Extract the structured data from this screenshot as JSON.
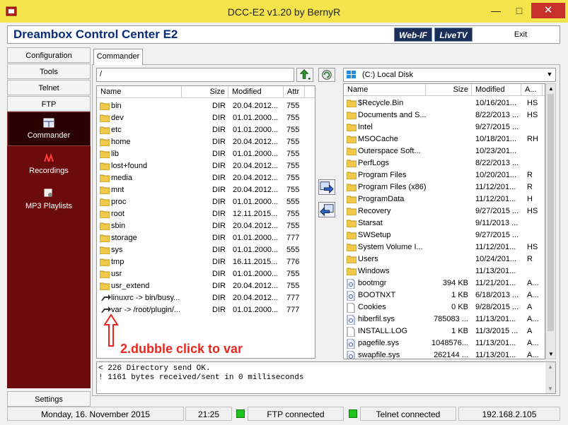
{
  "window": {
    "title": "DCC-E2 v1.20 by BernyR",
    "min": "—",
    "max": "□",
    "close": "✕"
  },
  "header": {
    "app_name": "Dreambox Control Center E2",
    "webif": "Web-IF",
    "livetv": "LiveTV",
    "exit": "Exit"
  },
  "nav": {
    "configuration": "Configuration",
    "tools": "Tools",
    "telnet": "Telnet",
    "ftp": "FTP",
    "commander": "Commander",
    "recordings": "Recordings",
    "mp3": "MP3 Playlists",
    "settings": "Settings"
  },
  "tab": {
    "commander": "Commander"
  },
  "remote": {
    "path": "/",
    "columns": {
      "name": "Name",
      "size": "Size",
      "modified": "Modified",
      "attr": "Attr"
    },
    "rows": [
      {
        "name": "bin",
        "size": "DIR",
        "modified": "20.04.2012...",
        "attr": "755",
        "icon": "folder-icon"
      },
      {
        "name": "dev",
        "size": "DIR",
        "modified": "01.01.2000...",
        "attr": "755",
        "icon": "folder-icon"
      },
      {
        "name": "etc",
        "size": "DIR",
        "modified": "01.01.2000...",
        "attr": "755",
        "icon": "folder-icon"
      },
      {
        "name": "home",
        "size": "DIR",
        "modified": "20.04.2012...",
        "attr": "755",
        "icon": "folder-icon"
      },
      {
        "name": "lib",
        "size": "DIR",
        "modified": "01.01.2000...",
        "attr": "755",
        "icon": "folder-icon"
      },
      {
        "name": "lost+found",
        "size": "DIR",
        "modified": "20.04.2012...",
        "attr": "755",
        "icon": "folder-icon"
      },
      {
        "name": "media",
        "size": "DIR",
        "modified": "20.04.2012...",
        "attr": "755",
        "icon": "folder-icon"
      },
      {
        "name": "mnt",
        "size": "DIR",
        "modified": "20.04.2012...",
        "attr": "755",
        "icon": "folder-icon"
      },
      {
        "name": "proc",
        "size": "DIR",
        "modified": "01.01.2000...",
        "attr": "555",
        "icon": "folder-icon"
      },
      {
        "name": "root",
        "size": "DIR",
        "modified": "12.11.2015...",
        "attr": "755",
        "icon": "folder-icon"
      },
      {
        "name": "sbin",
        "size": "DIR",
        "modified": "20.04.2012...",
        "attr": "755",
        "icon": "folder-icon"
      },
      {
        "name": "storage",
        "size": "DIR",
        "modified": "01.01.2000...",
        "attr": "777",
        "icon": "folder-icon"
      },
      {
        "name": "sys",
        "size": "DIR",
        "modified": "01.01.2000...",
        "attr": "555",
        "icon": "folder-icon"
      },
      {
        "name": "tmp",
        "size": "DIR",
        "modified": "16.11.2015...",
        "attr": "776",
        "icon": "folder-icon"
      },
      {
        "name": "usr",
        "size": "DIR",
        "modified": "01.01.2000...",
        "attr": "755",
        "icon": "folder-icon"
      },
      {
        "name": "usr_extend",
        "size": "DIR",
        "modified": "20.04.2012...",
        "attr": "755",
        "icon": "folder-icon"
      },
      {
        "name": "linuxrc -> bin/busy...",
        "size": "DIR",
        "modified": "20.04.2012...",
        "attr": "777",
        "icon": "symlink-icon"
      },
      {
        "name": "var -> /root/plugin/...",
        "size": "DIR",
        "modified": "01.01.2000...",
        "attr": "777",
        "icon": "symlink-icon"
      }
    ]
  },
  "local": {
    "drive": "(C:)  Local Disk",
    "columns": {
      "name": "Name",
      "size": "Size",
      "modified": "Modified",
      "attr": "A..."
    },
    "rows": [
      {
        "name": "$Recycle.Bin",
        "size": "",
        "modified": "10/16/201...",
        "attr": "HS",
        "icon": "folder-icon"
      },
      {
        "name": "Documents and S...",
        "size": "",
        "modified": "8/22/2013 ...",
        "attr": "HS",
        "icon": "folder-icon"
      },
      {
        "name": "Intel",
        "size": "",
        "modified": "9/27/2015 ...",
        "attr": "",
        "icon": "folder-icon"
      },
      {
        "name": "MSOCache",
        "size": "",
        "modified": "10/18/201...",
        "attr": "RH",
        "icon": "folder-icon"
      },
      {
        "name": "Outerspace Soft...",
        "size": "",
        "modified": "10/23/201...",
        "attr": "",
        "icon": "folder-icon"
      },
      {
        "name": "PerfLogs",
        "size": "",
        "modified": "8/22/2013 ...",
        "attr": "",
        "icon": "folder-icon"
      },
      {
        "name": "Program Files",
        "size": "",
        "modified": "10/20/201...",
        "attr": "R",
        "icon": "folder-icon"
      },
      {
        "name": "Program Files (x86)",
        "size": "",
        "modified": "11/12/201...",
        "attr": "R",
        "icon": "folder-icon"
      },
      {
        "name": "ProgramData",
        "size": "",
        "modified": "11/12/201...",
        "attr": "H",
        "icon": "folder-icon"
      },
      {
        "name": "Recovery",
        "size": "",
        "modified": "9/27/2015 ...",
        "attr": "HS",
        "icon": "folder-icon"
      },
      {
        "name": "Starsat",
        "size": "",
        "modified": "9/11/2013 ...",
        "attr": "",
        "icon": "folder-icon"
      },
      {
        "name": "SWSetup",
        "size": "",
        "modified": "9/27/2015 ...",
        "attr": "",
        "icon": "folder-icon"
      },
      {
        "name": "System Volume I...",
        "size": "",
        "modified": "11/12/201...",
        "attr": "HS",
        "icon": "folder-icon"
      },
      {
        "name": "Users",
        "size": "",
        "modified": "10/24/201...",
        "attr": "R",
        "icon": "folder-icon"
      },
      {
        "name": "Windows",
        "size": "",
        "modified": "11/13/201...",
        "attr": "",
        "icon": "folder-icon"
      },
      {
        "name": "bootmgr",
        "size": "394 KB",
        "modified": "11/21/201...",
        "attr": "A...",
        "icon": "system-file-icon"
      },
      {
        "name": "BOOTNXT",
        "size": "1 KB",
        "modified": "6/18/2013 ...",
        "attr": "A...",
        "icon": "system-file-icon"
      },
      {
        "name": "Cookies",
        "size": "0 KB",
        "modified": "9/28/2015 ...",
        "attr": "A",
        "icon": "file-icon"
      },
      {
        "name": "hiberfil.sys",
        "size": "785083 ...",
        "modified": "11/13/201...",
        "attr": "A...",
        "icon": "system-file-icon"
      },
      {
        "name": "INSTALL.LOG",
        "size": "1 KB",
        "modified": "11/3/2015 ...",
        "attr": "A",
        "icon": "file-icon"
      },
      {
        "name": "pagefile.sys",
        "size": "1048576...",
        "modified": "11/13/201...",
        "attr": "A...",
        "icon": "system-file-icon"
      },
      {
        "name": "swapfile.sys",
        "size": "262144 ...",
        "modified": "11/13/201...",
        "attr": "A...",
        "icon": "system-file-icon"
      }
    ]
  },
  "log": {
    "line1": "< 226 Directory send OK.",
    "line2": "! 1161 bytes received/sent in 0 milliseconds"
  },
  "status": {
    "date": "Monday, 16. November 2015",
    "time": "21:25",
    "ftp": "FTP connected",
    "telnet": "Telnet connected",
    "ip": "192.168.2.105"
  },
  "annotation": {
    "text": "2.dubble click to var"
  },
  "colors": {
    "accent": "#0a2b7a",
    "nav_bg": "#6b0b0b",
    "titlebar": "#f5e34c",
    "annotation": "#e8271f",
    "status_led": "#1ec41e"
  }
}
